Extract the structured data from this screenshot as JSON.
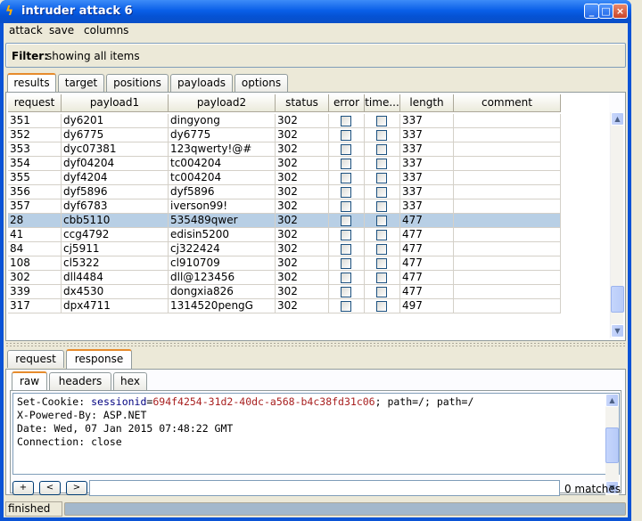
{
  "window": {
    "title": "intruder attack 6"
  },
  "titlebar_buttons": {
    "minimize": "_",
    "maximize": "□",
    "close": "×"
  },
  "menu": [
    "attack",
    "save",
    "columns"
  ],
  "filter": {
    "label": "Filter:",
    "value": "showing all items"
  },
  "top_tabs": [
    "results",
    "target",
    "positions",
    "payloads",
    "options"
  ],
  "table": {
    "columns": [
      "request",
      "payload1",
      "payload2",
      "status",
      "error",
      "time...",
      "length",
      "comment"
    ],
    "rows": [
      {
        "request": "351",
        "payload1": "dy6201",
        "payload2": "dingyong",
        "status": "302",
        "error": false,
        "timeout": false,
        "length": "337",
        "comment": "",
        "selected": false
      },
      {
        "request": "352",
        "payload1": "dy6775",
        "payload2": "dy6775",
        "status": "302",
        "error": false,
        "timeout": false,
        "length": "337",
        "comment": "",
        "selected": false
      },
      {
        "request": "353",
        "payload1": "dyc07381",
        "payload2": "123qwerty!@#",
        "status": "302",
        "error": false,
        "timeout": false,
        "length": "337",
        "comment": "",
        "selected": false
      },
      {
        "request": "354",
        "payload1": "dyf04204",
        "payload2": "tc004204",
        "status": "302",
        "error": false,
        "timeout": false,
        "length": "337",
        "comment": "",
        "selected": false
      },
      {
        "request": "355",
        "payload1": "dyf4204",
        "payload2": "tc004204",
        "status": "302",
        "error": false,
        "timeout": false,
        "length": "337",
        "comment": "",
        "selected": false
      },
      {
        "request": "356",
        "payload1": "dyf5896",
        "payload2": "dyf5896",
        "status": "302",
        "error": false,
        "timeout": false,
        "length": "337",
        "comment": "",
        "selected": false
      },
      {
        "request": "357",
        "payload1": "dyf6783",
        "payload2": "iverson99!",
        "status": "302",
        "error": false,
        "timeout": false,
        "length": "337",
        "comment": "",
        "selected": false
      },
      {
        "request": "28",
        "payload1": "cbb5110",
        "payload2": "535489qwer",
        "status": "302",
        "error": false,
        "timeout": false,
        "length": "477",
        "comment": "",
        "selected": true
      },
      {
        "request": "41",
        "payload1": "ccg4792",
        "payload2": "edisin5200",
        "status": "302",
        "error": false,
        "timeout": false,
        "length": "477",
        "comment": "",
        "selected": false
      },
      {
        "request": "84",
        "payload1": "cj5911",
        "payload2": "cj322424",
        "status": "302",
        "error": false,
        "timeout": false,
        "length": "477",
        "comment": "",
        "selected": false
      },
      {
        "request": "108",
        "payload1": "cl5322",
        "payload2": "cl910709",
        "status": "302",
        "error": false,
        "timeout": false,
        "length": "477",
        "comment": "",
        "selected": false
      },
      {
        "request": "302",
        "payload1": "dll4484",
        "payload2": "dll@123456",
        "status": "302",
        "error": false,
        "timeout": false,
        "length": "477",
        "comment": "",
        "selected": false
      },
      {
        "request": "339",
        "payload1": "dx4530",
        "payload2": "dongxia826",
        "status": "302",
        "error": false,
        "timeout": false,
        "length": "477",
        "comment": "",
        "selected": false
      },
      {
        "request": "317",
        "payload1": "dpx4711",
        "payload2": "1314520pengG",
        "status": "302",
        "error": false,
        "timeout": false,
        "length": "497",
        "comment": "",
        "selected": false
      }
    ]
  },
  "detail_tabs": [
    "request",
    "response"
  ],
  "view_tabs": [
    "raw",
    "headers",
    "hex"
  ],
  "response": {
    "line1_prefix": "Set-Cookie: ",
    "line1_name": "sessionid",
    "line1_eq": "=",
    "line1_value": "694f4254-31d2-40dc-a568-b4c38fd31c06",
    "line1_suffix": "; path=/; path=/",
    "line2": "X-Powered-By: ASP.NET",
    "line3": "Date: Wed, 07 Jan 2015 07:48:22 GMT",
    "line4": "Connection: close"
  },
  "search": {
    "buttons": [
      "+",
      "<",
      ">"
    ],
    "value": "",
    "matches": "0 matches"
  },
  "status": {
    "text": "finished",
    "progress": 1.0
  }
}
